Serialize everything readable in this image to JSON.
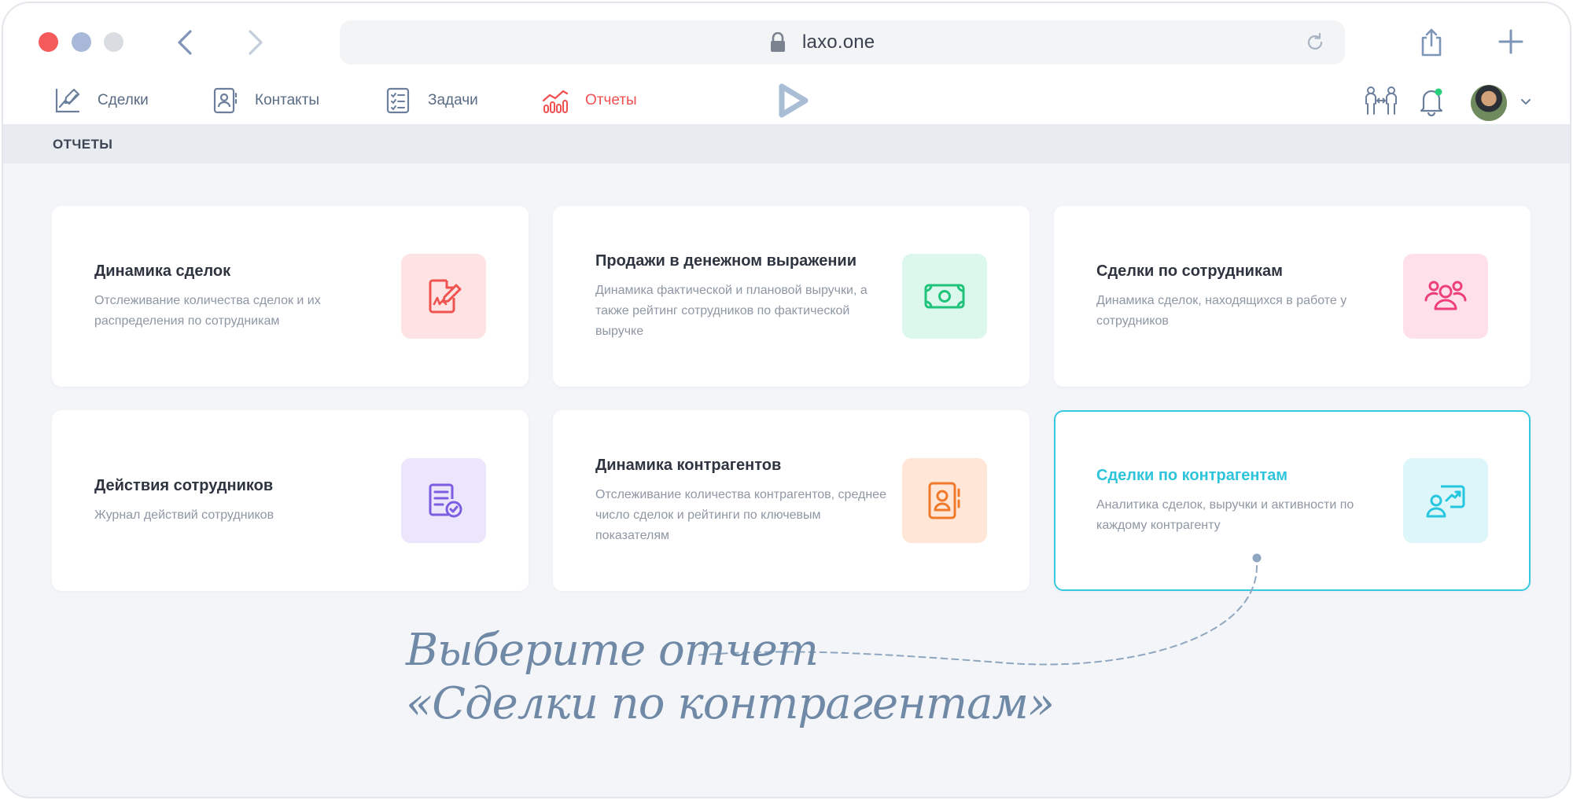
{
  "browser": {
    "url": "laxo.one",
    "traffic_lights": [
      "#f65b5b",
      "#a7b8d8",
      "#d9dde2"
    ]
  },
  "nav": {
    "tabs": [
      {
        "label": "Сделки",
        "icon": "deals-chart-icon",
        "active": false
      },
      {
        "label": "Контакты",
        "icon": "contact-book-icon",
        "active": false
      },
      {
        "label": "Задачи",
        "icon": "checklist-icon",
        "active": false
      },
      {
        "label": "Отчеты",
        "icon": "bar-chart-icon",
        "active": true
      }
    ],
    "accent_color": "#f0504f"
  },
  "page": {
    "title": "ОТЧЕТЫ"
  },
  "reports": [
    {
      "title": "Динамика сделок",
      "description": "Отслеживание количества сделок и их распределения по сотрудникам",
      "icon": "signed-document-icon",
      "icon_color": "#ef5350",
      "icon_bg": "#fde3e4"
    },
    {
      "title": "Продажи в денежном выражении",
      "description": "Динамика фактической и плановой выручки, а также рейтинг сотрудников по фактической выручке",
      "icon": "banknote-icon",
      "icon_color": "#1fc47a",
      "icon_bg": "#dcf7ec"
    },
    {
      "title": "Сделки по сотрудникам",
      "description": "Динамика сделок, находящихся в работе у сотрудников",
      "icon": "team-icon",
      "icon_color": "#ee3f7c",
      "icon_bg": "#fde0ea"
    },
    {
      "title": "Действия сотрудников",
      "description": "Журнал действий сотрудников",
      "icon": "document-check-icon",
      "icon_color": "#7c5ce0",
      "icon_bg": "#ebe6fb"
    },
    {
      "title": "Динамика контрагентов",
      "description": "Отслеживание количества контрагентов, среднее число сделок и рейтинги по ключевым показателям",
      "icon": "address-book-icon",
      "icon_color": "#f07a2c",
      "icon_bg": "#ffe6d6"
    },
    {
      "title": "Сделки по контрагентам",
      "description": "Аналитика сделок, выручки и активности по каждому контрагенту",
      "icon": "presentation-user-icon",
      "icon_color": "#27c6df",
      "icon_bg": "#dcf6fa",
      "selected": true
    }
  ],
  "hint": {
    "line1": "Выберите отчет",
    "line2": "«Сделки по контрагентам»"
  }
}
